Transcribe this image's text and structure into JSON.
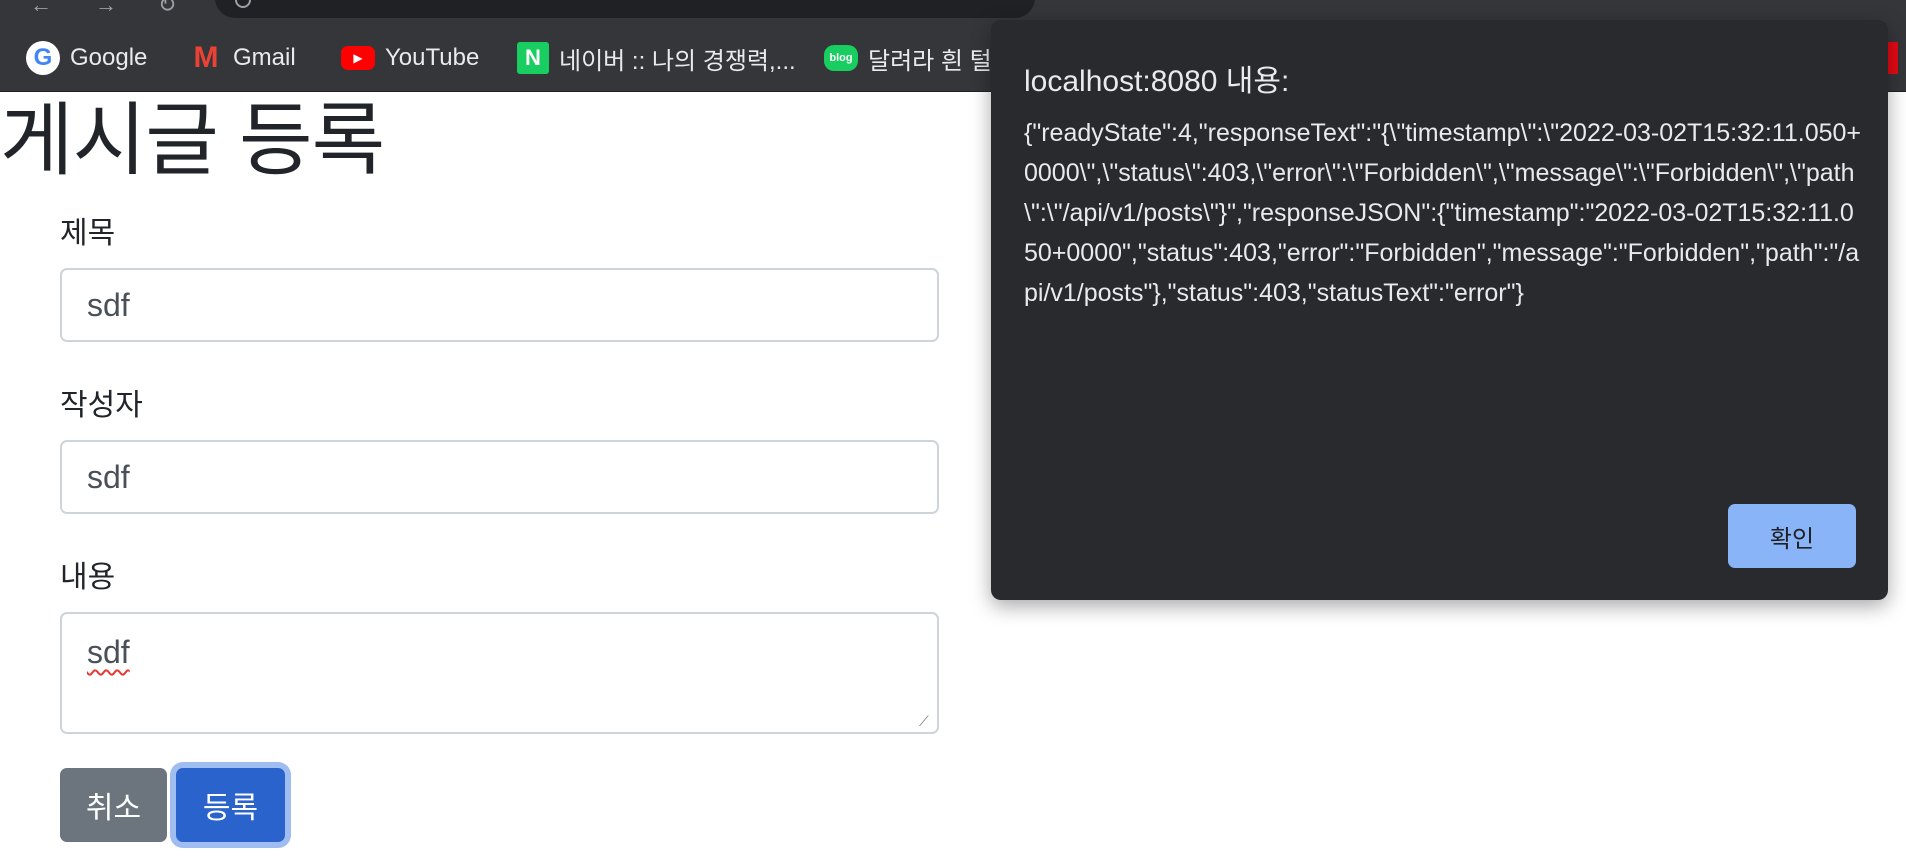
{
  "bookmarks": [
    {
      "label": "Google",
      "icon": "google-icon"
    },
    {
      "label": "Gmail",
      "icon": "gmail-icon"
    },
    {
      "label": "YouTube",
      "icon": "youtube-icon"
    },
    {
      "label": "네이버 :: 나의 경쟁력,...",
      "icon": "naver-icon"
    },
    {
      "label": "달려라 흰 털",
      "icon": "naver-blog-icon"
    }
  ],
  "page": {
    "title": "게시글 등록",
    "fields": [
      {
        "label": "제목",
        "value": "sdf"
      },
      {
        "label": "작성자",
        "value": "sdf"
      },
      {
        "label": "내용",
        "value": "sdf"
      }
    ],
    "cancel_label": "취소",
    "submit_label": "등록"
  },
  "alert": {
    "title": "localhost:8080 내용:",
    "message": "{\"readyState\":4,\"responseText\":\"{\\\"timestamp\\\":\\\"2022-03-02T15:32:11.050+0000\\\",\\\"status\\\":403,\\\"error\\\":\\\"Forbidden\\\",\\\"message\\\":\\\"Forbidden\\\",\\\"path\\\":\\\"/api/v1/posts\\\"}\",\"responseJSON\":{\"timestamp\":\"2022-03-02T15:32:11.050+0000\",\"status\":403,\"error\":\"Forbidden\",\"message\":\"Forbidden\",\"path\":\"/api/v1/posts\"},\"status\":403,\"statusText\":\"error\"}",
    "ok_label": "확인"
  },
  "colors": {
    "chrome_bg": "#35363a",
    "dialog_bg": "#292a2d",
    "dialog_button": "#8ab4f8",
    "primary_button": "#2b63cc",
    "secondary_button": "#6c757d"
  }
}
